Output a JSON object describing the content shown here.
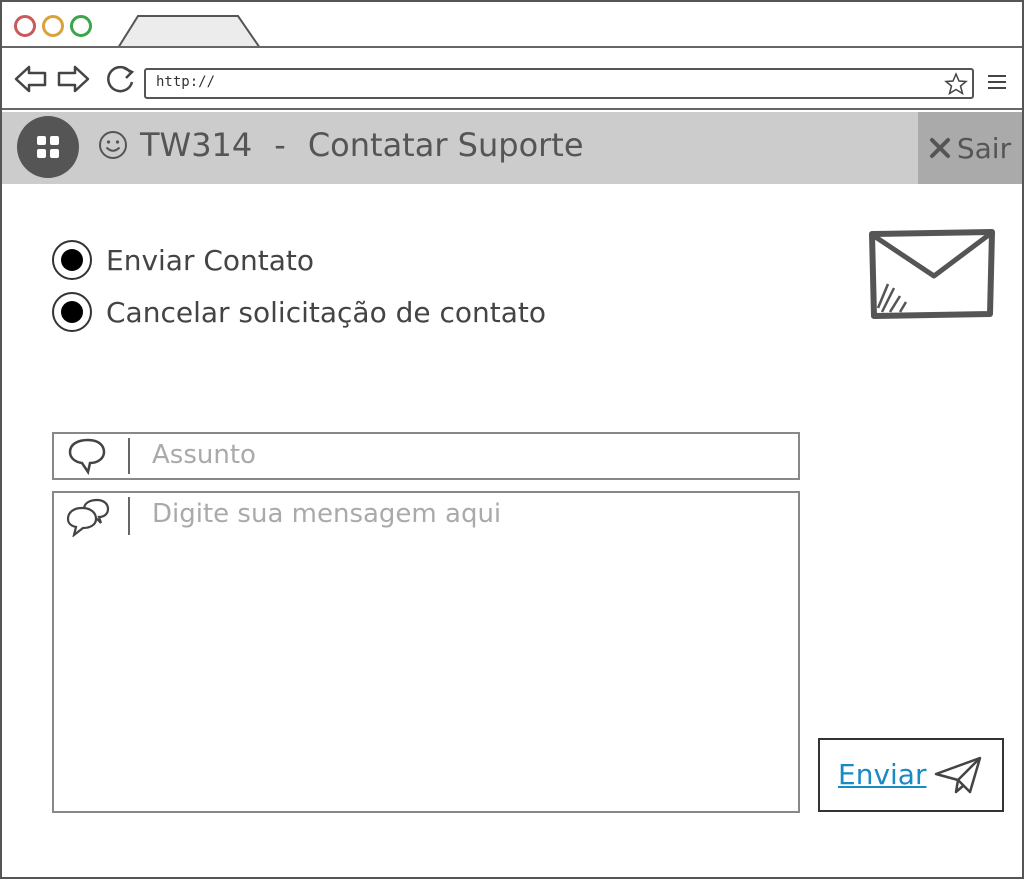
{
  "browser": {
    "url": "http://",
    "controls": {
      "close_color": "#c85a5a",
      "minimize_color": "#d9a23a",
      "maximize_color": "#3aa64a"
    }
  },
  "header": {
    "app_code": "TW314",
    "separator": "-",
    "title": "Contatar Suporte",
    "logout_label": "Sair",
    "colors": {
      "bar": "#cccccc",
      "logout": "#aaaaaa"
    }
  },
  "options": [
    {
      "label": "Enviar Contato",
      "selected": true
    },
    {
      "label": "Cancelar solicitação de contato",
      "selected": true
    }
  ],
  "form": {
    "subject_placeholder": "Assunto",
    "message_placeholder": "Digite sua mensagem aqui",
    "send_label": "Enviar",
    "send_color": "#1a8ac4"
  },
  "icons": [
    "back-arrow-icon",
    "forward-arrow-icon",
    "reload-icon",
    "star-icon",
    "hamburger-icon",
    "grid-icon",
    "smiley-icon",
    "close-x-icon",
    "envelope-icon",
    "speech-bubble-icon",
    "speech-bubbles-icon",
    "paper-plane-icon"
  ]
}
